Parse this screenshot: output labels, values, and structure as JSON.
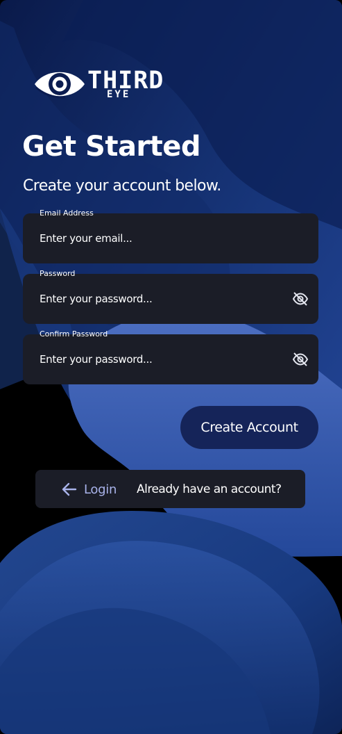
{
  "brand": {
    "name": "THIRD",
    "sub": "EYE"
  },
  "header": {
    "title": "Get Started",
    "subtitle": "Create your account below."
  },
  "form": {
    "email": {
      "label": "Email Address",
      "placeholder": "Enter your email..."
    },
    "password": {
      "label": "Password",
      "placeholder": "Enter your password...",
      "toggle_icon": "eye-off-icon"
    },
    "confirm_password": {
      "label": "Confirm Password",
      "placeholder": "Enter your password...",
      "toggle_icon": "eye-off-icon"
    },
    "submit_label": "Create Account"
  },
  "footer": {
    "login_label": "Login",
    "login_icon": "arrow-left-icon",
    "prompt": "Already have an account?"
  },
  "colors": {
    "field_bg": "#1b1d27",
    "button_bg": "#152459",
    "login_accent": "#a9b3ea"
  }
}
